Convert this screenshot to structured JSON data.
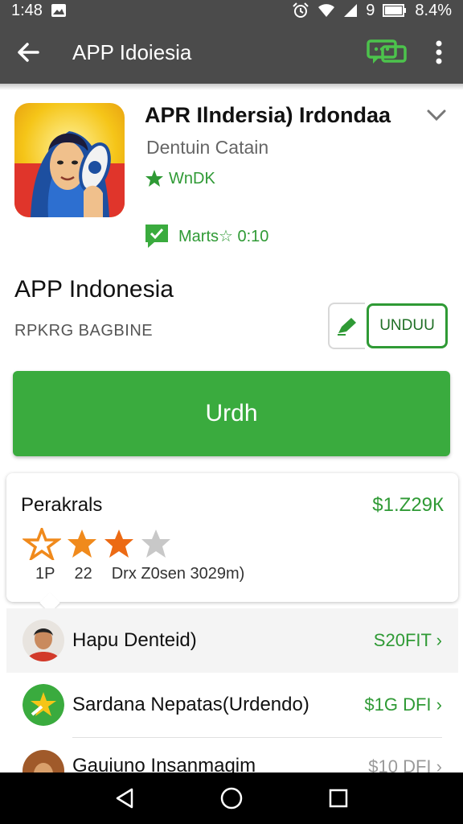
{
  "status_bar": {
    "time": "1:48",
    "carrier_number": "9",
    "battery_label": "8.4%"
  },
  "toolbar": {
    "title": "APP Idoiesia"
  },
  "header": {
    "app_title": "APR Ilndersia) Irdondaa",
    "developer": "Dentuin Catain",
    "rating_text": "WnDK",
    "message_text": "Marts☆ 0:10"
  },
  "app_info": {
    "name": "APP Indonesia",
    "category": "RPKRG BAGBINE",
    "unduh_label": "UNDUU"
  },
  "install": {
    "label": "Urdh"
  },
  "card": {
    "title": "Perakrals",
    "price": "$1.Z29К",
    "rating": 2.5,
    "meta": [
      "1P",
      "22",
      "Drx Z0sen 3029m)"
    ]
  },
  "list": [
    {
      "name": "Hapu Denteid)",
      "price": "S20FIT"
    },
    {
      "name": "Sardana Nepatas(Urdendo)",
      "price": "$1G DFI"
    },
    {
      "name": "Gauiuno Insanmagim",
      "price": "$10 DFI"
    }
  ],
  "colors": {
    "accent_green": "#3aab3e",
    "toolbar_gray": "#4b4b4b",
    "star_orange": "#f08a1c"
  },
  "icons": {
    "back": "arrow-left-icon",
    "chat": "chat-icon",
    "more": "more-vert-icon",
    "chevron": "chevron-down-icon",
    "edit": "pencil-icon",
    "nav_back": "triangle-back-icon",
    "nav_home": "circle-home-icon",
    "nav_recent": "square-recent-icon"
  }
}
